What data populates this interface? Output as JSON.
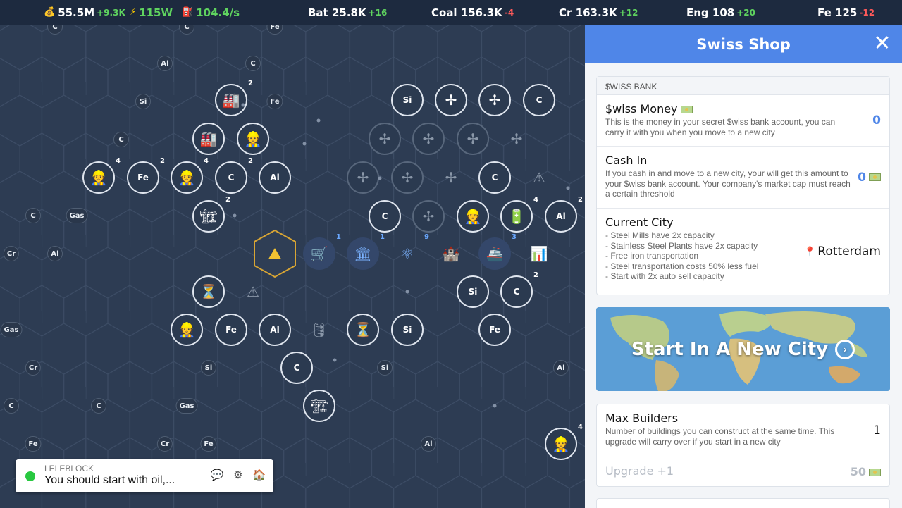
{
  "resources": [
    {
      "icon": "money-bag-icon",
      "glyph": "💰",
      "value": "55.5M",
      "delta": "+9.3K",
      "trend": "up"
    },
    {
      "icon": "power-icon",
      "glyph": "⚡",
      "value": "115W",
      "delta": "",
      "trend": "up"
    },
    {
      "icon": "fuel-icon",
      "glyph": "⛽",
      "value": "104.4/s",
      "delta": "",
      "trend": "up"
    },
    {
      "icon": "",
      "glyph": "",
      "value": "Bat 25.8K",
      "delta": "+16",
      "trend": "up"
    },
    {
      "icon": "",
      "glyph": "",
      "value": "Coal 156.3K",
      "delta": "-4",
      "trend": "down"
    },
    {
      "icon": "",
      "glyph": "",
      "value": "Cr 163.3K",
      "delta": "+12",
      "trend": "up"
    },
    {
      "icon": "",
      "glyph": "",
      "value": "Eng 108",
      "delta": "+20",
      "trend": "up"
    },
    {
      "icon": "",
      "glyph": "",
      "value": "Fe 125",
      "delta": "-12",
      "trend": "down"
    }
  ],
  "colors": {
    "positive": "#5fd35f",
    "negative": "#ff5a5a",
    "accent": "#4f86e8",
    "hq_gold": "#d8a534"
  },
  "map": {
    "tags": [
      "C",
      "C",
      "Fe",
      "Al",
      "C",
      "Si",
      "Fe",
      "C",
      "C",
      "Gas",
      "Cr",
      "Al",
      "Gas",
      "Cr",
      "Si",
      "Si",
      "Al",
      "C",
      "C",
      "Gas",
      "Fe",
      "Cr",
      "Fe",
      "Al"
    ],
    "counts": {
      "c1": "2",
      "c2": "4",
      "c3": "2",
      "c4": "4",
      "c5": "2",
      "c6": "2",
      "c7": "1",
      "c8": "1",
      "c9": "9",
      "c10": "3",
      "c11": "4",
      "c12": "2",
      "c13": "2",
      "c14": "4"
    },
    "node_labels": {
      "fe": "Fe",
      "c": "C",
      "al": "Al",
      "si": "Si"
    }
  },
  "chat": {
    "username": "LELEBLOCK",
    "message": "You should start with oil,..."
  },
  "panel": {
    "title": "Swiss Shop",
    "bank_section": "$WISS BANK",
    "swiss_money": {
      "title": "$wiss Money",
      "desc": "This is the money in your secret $wiss bank account, you can carry it with you when you move to a new city",
      "value": "0"
    },
    "cash_in": {
      "title": "Cash In",
      "desc": "If you cash in and move to a new city, your will get this amount to your $wiss bank account. Your company's market cap must reach a certain threshold",
      "value": "0"
    },
    "current_city": {
      "title": "Current City",
      "desc": [
        "- Steel Mills have 2x capacity",
        "- Stainless Steel Plants have 2x capacity",
        "- Free iron transportation",
        "- Steel transportation costs 50% less fuel",
        "- Start with 2x auto sell capacity"
      ],
      "value": "Rotterdam"
    },
    "new_city_button": "Start In A New City",
    "max_builders": {
      "title": "Max Builders",
      "desc": "Number of buildings you can construct at the same time. This upgrade will carry over if you start in a new city",
      "value": "1"
    },
    "upgrade": {
      "label": "Upgrade +1",
      "cost": "50"
    }
  }
}
